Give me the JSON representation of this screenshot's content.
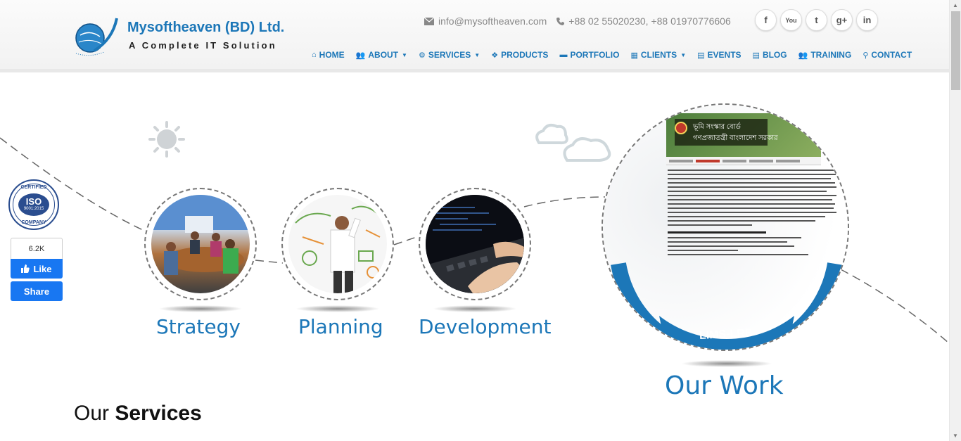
{
  "header": {
    "company_name": "Mysoftheaven (BD) Ltd.",
    "tagline": "A Complete IT Solution",
    "email": "info@mysoftheaven.com",
    "phone": "+88 02 55020230,  +88 01970776606",
    "social": [
      {
        "icon": "facebook-icon",
        "glyph": "f"
      },
      {
        "icon": "youtube-icon",
        "glyph": "You"
      },
      {
        "icon": "twitter-icon",
        "glyph": "t"
      },
      {
        "icon": "google-plus-icon",
        "glyph": "g+"
      },
      {
        "icon": "linkedin-icon",
        "glyph": "in"
      }
    ]
  },
  "nav": {
    "home": "HOME",
    "about": "ABOUT",
    "services": "SERVICES",
    "products": "PRODUCTS",
    "portfolio": "PORTFOLIO",
    "clients": "CLIENTS",
    "events": "EVENTS",
    "blog": "BLOG",
    "training": "TRAINING",
    "contact": "CONTACT"
  },
  "hero": {
    "stages": [
      "Strategy",
      "Planning",
      "Development"
    ],
    "our_work": "Our Work",
    "work_banner_line1": "ভূমি সংস্কার বোর্ড",
    "work_banner_line2": "গণপ্রজাতন্ত্রী বাংলাদেশ সরকার",
    "work_label": "LIMS-LRB"
  },
  "badges": {
    "iso_top": "CERTIFIED",
    "iso_main": "ISO",
    "iso_sub": "9001:2015",
    "iso_bottom": "COMPANY"
  },
  "facebook": {
    "count": "6.2K",
    "like": "Like",
    "share": "Share"
  },
  "services": {
    "title_light": "Our",
    "title_bold": "Services"
  },
  "colors": {
    "brand": "#1c77b8",
    "facebook": "#1877f2"
  }
}
